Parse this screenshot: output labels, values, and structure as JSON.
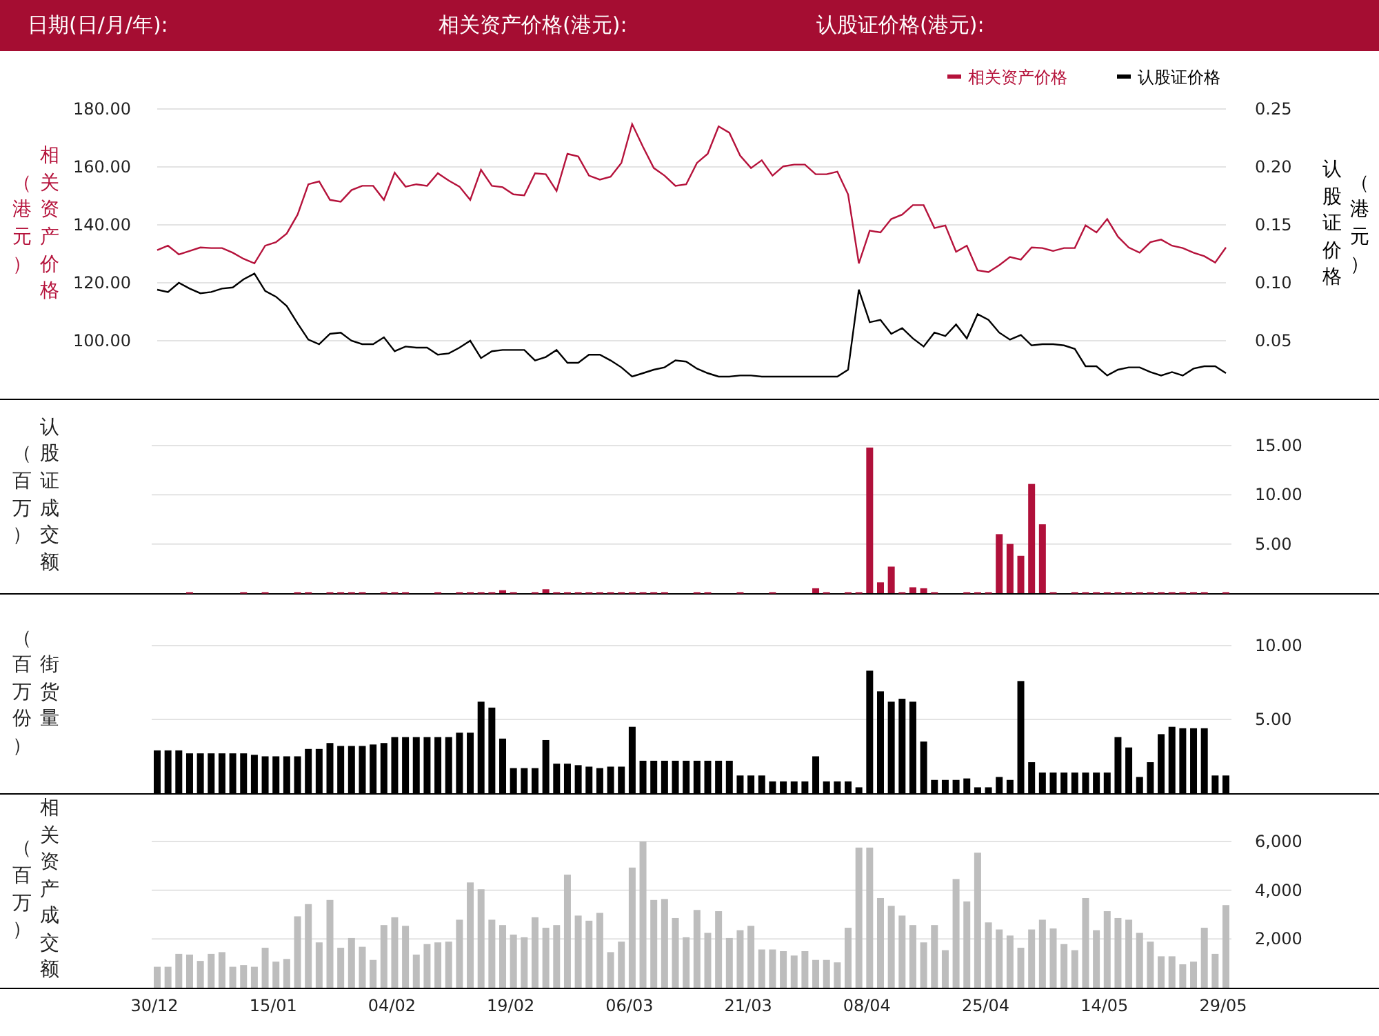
{
  "header": {
    "fields": [
      {
        "label": "日期(日/月/年):"
      },
      {
        "label": "相关资产价格(港元):"
      },
      {
        "label": "认股证价格(港元):"
      }
    ]
  },
  "price_chart": {
    "left_title": "相关资产价格",
    "left_unit": "（港元）",
    "right_title": "认股证价格",
    "right_unit": "（港元）",
    "chart_data": {
      "type": "line",
      "grid": true,
      "legend": "top-right",
      "ylim": [
        80,
        180
      ],
      "y2lim": [
        0,
        0.25
      ],
      "yticks": [
        {
          "value": 180,
          "label": "180.00"
        },
        {
          "value": 160,
          "label": "160.00"
        },
        {
          "value": 140,
          "label": "140.00"
        },
        {
          "value": 120,
          "label": "120.00"
        },
        {
          "value": 100,
          "label": "100.00"
        }
      ],
      "y2ticks": [
        {
          "value": 0.25,
          "label": "0.25"
        },
        {
          "value": 0.2,
          "label": "0.20"
        },
        {
          "value": 0.15,
          "label": "0.15"
        },
        {
          "value": 0.1,
          "label": "0.10"
        },
        {
          "value": 0.05,
          "label": "0.05"
        }
      ],
      "series": [
        {
          "name": "相关资产价格",
          "color": "#b5123b",
          "values": [
            131.3,
            132.8,
            129.8,
            131,
            132.2,
            132,
            132,
            130.4,
            128.3,
            126.7,
            132.8,
            134,
            137,
            143.5,
            154,
            155,
            148.6,
            148,
            152,
            153.5,
            153.5,
            148.6,
            158,
            153.2,
            154,
            153.5,
            157.8,
            155.3,
            153.2,
            148.6,
            159,
            153.5,
            153,
            150.5,
            150.2,
            157.8,
            157.5,
            151.7,
            164.5,
            163.6,
            157,
            155.6,
            156.6,
            161.4,
            174.8,
            166.9,
            159.6,
            157,
            153.5,
            154,
            161.4,
            164.5,
            174,
            171.8,
            163.9,
            159.6,
            162.3,
            157,
            160.2,
            160.8,
            160.8,
            157.5,
            157.5,
            158.4,
            150.5,
            126.7,
            138,
            137.4,
            142,
            143.5,
            146.8,
            146.8,
            138.9,
            139.8,
            130.7,
            132.8,
            124.3,
            123.7,
            126.1,
            128.9,
            128,
            132.2,
            132,
            131,
            132,
            132,
            139.8,
            137.4,
            142,
            135.9,
            132.2,
            130.4,
            134,
            134.9,
            132.8,
            132,
            130.4,
            129.2,
            127,
            132.2
          ]
        },
        {
          "name": "认股证价格",
          "color": "#000000",
          "axis": "y2",
          "values": [
            0.094,
            0.092,
            0.1,
            0.095,
            0.091,
            0.092,
            0.095,
            0.096,
            0.103,
            0.108,
            0.093,
            0.088,
            0.08,
            0.065,
            0.051,
            0.047,
            0.056,
            0.057,
            0.05,
            0.047,
            0.047,
            0.053,
            0.041,
            0.045,
            0.044,
            0.044,
            0.038,
            0.039,
            0.044,
            0.05,
            0.035,
            0.041,
            0.042,
            0.042,
            0.042,
            0.033,
            0.036,
            0.042,
            0.031,
            0.031,
            0.038,
            0.038,
            0.033,
            0.027,
            0.019,
            0.022,
            0.025,
            0.027,
            0.033,
            0.032,
            0.026,
            0.022,
            0.019,
            0.019,
            0.02,
            0.02,
            0.019,
            0.019,
            0.019,
            0.019,
            0.019,
            0.019,
            0.019,
            0.019,
            0.025,
            0.094,
            0.066,
            0.068,
            0.056,
            0.061,
            0.052,
            0.045,
            0.057,
            0.054,
            0.064,
            0.052,
            0.073,
            0.068,
            0.057,
            0.051,
            0.055,
            0.046,
            0.047,
            0.047,
            0.046,
            0.043,
            0.028,
            0.028,
            0.02,
            0.025,
            0.027,
            0.027,
            0.023,
            0.02,
            0.023,
            0.02,
            0.026,
            0.028,
            0.028,
            0.022
          ]
        }
      ]
    }
  },
  "volume_charts": [
    {
      "unit": "（百万）",
      "chart_data": {
        "type": "bar",
        "grid": true,
        "ylim": [
          0,
          15
        ],
        "yticks": [
          {
            "value": 15,
            "label": "15.00"
          },
          {
            "value": 10,
            "label": "10.00"
          },
          {
            "value": 5,
            "label": "5.00"
          }
        ],
        "series": [
          {
            "name": "认股证成交额",
            "color": "#b0103a",
            "values": [
              0,
              0,
              0,
              0.1,
              0,
              0,
              0,
              0,
              0.1,
              0,
              0.1,
              0,
              0,
              0.1,
              0.1,
              0,
              0.1,
              0.1,
              0.1,
              0.1,
              0,
              0.1,
              0.1,
              0.1,
              0,
              0,
              0.1,
              0,
              0.1,
              0.1,
              0.1,
              0.1,
              0.3,
              0.1,
              0,
              0.1,
              0.4,
              0.1,
              0.1,
              0.1,
              0.1,
              0.1,
              0.1,
              0.1,
              0.1,
              0.1,
              0.1,
              0.1,
              0,
              0,
              0.1,
              0.1,
              0,
              0,
              0.1,
              0,
              0,
              0.1,
              0,
              0,
              0,
              0.5,
              0.1,
              0,
              0.1,
              0.1,
              14.8,
              1.1,
              2.7,
              0.1,
              0.6,
              0.5,
              0.1,
              0,
              0,
              0.1,
              0.1,
              0.1,
              6,
              5,
              3.8,
              11.1,
              7,
              0.1,
              0,
              0.1,
              0.1,
              0.1,
              0.1,
              0.1,
              0.1,
              0.1,
              0.1,
              0.1,
              0.1,
              0.1,
              0.1,
              0.1,
              0,
              0.1
            ]
          }
        ]
      }
    },
    {
      "unit": "（百万份）",
      "chart_data": {
        "type": "bar",
        "grid": true,
        "ylim": [
          0,
          10
        ],
        "yticks": [
          {
            "value": 10,
            "label": "10.00"
          },
          {
            "value": 5,
            "label": "5.00"
          }
        ],
        "series": [
          {
            "name": "街货量",
            "color": "#000000",
            "values": [
              2.9,
              2.9,
              2.9,
              2.7,
              2.7,
              2.7,
              2.7,
              2.7,
              2.7,
              2.6,
              2.5,
              2.5,
              2.5,
              2.5,
              3,
              3,
              3.4,
              3.2,
              3.2,
              3.2,
              3.3,
              3.4,
              3.8,
              3.8,
              3.8,
              3.8,
              3.8,
              3.8,
              4.1,
              4.1,
              6.2,
              5.8,
              3.7,
              1.7,
              1.7,
              1.7,
              3.6,
              2,
              2,
              1.9,
              1.8,
              1.7,
              1.8,
              1.8,
              4.5,
              2.2,
              2.2,
              2.2,
              2.2,
              2.2,
              2.2,
              2.2,
              2.2,
              2.2,
              1.2,
              1.2,
              1.2,
              0.8,
              0.8,
              0.8,
              0.8,
              2.5,
              0.8,
              0.8,
              0.8,
              0.4,
              8.3,
              6.9,
              6.2,
              6.4,
              6.2,
              3.5,
              0.9,
              0.9,
              0.9,
              1,
              0.4,
              0.4,
              1.1,
              0.9,
              7.6,
              2.1,
              1.4,
              1.4,
              1.4,
              1.4,
              1.4,
              1.4,
              1.4,
              3.8,
              3.1,
              1.1,
              2.1,
              4,
              4.5,
              4.4,
              4.4,
              4.4,
              1.2,
              1.2
            ]
          }
        ]
      }
    },
    {
      "unit": "（百万）",
      "date_labels": [
        "30/12",
        "15/01",
        "04/02",
        "19/02",
        "06/03",
        "21/03",
        "08/04",
        "25/04",
        "14/05",
        "29/05"
      ],
      "chart_data": {
        "type": "bar",
        "grid": true,
        "ylim": [
          0,
          6000
        ],
        "yticks": [
          {
            "value": 6000,
            "label": "6,000"
          },
          {
            "value": 4000,
            "label": "4,000"
          },
          {
            "value": 2000,
            "label": "2,000"
          }
        ],
        "series": [
          {
            "name": "相关资产成交额",
            "color": "#bdbdbd",
            "values": [
              860,
              860,
              1390,
              1360,
              1100,
              1390,
              1460,
              860,
              930,
              860,
              1640,
              1070,
              1180,
              2930,
              3430,
              1860,
              3600,
              1640,
              2040,
              1680,
              1140,
              2570,
              2890,
              2540,
              1360,
              1790,
              1860,
              1890,
              2790,
              4320,
              4040,
              2790,
              2570,
              2180,
              2070,
              2890,
              2460,
              2570,
              4640,
              2960,
              2750,
              3070,
              1460,
              1890,
              4930,
              6000,
              3600,
              3640,
              2860,
              2070,
              3190,
              2250,
              3140,
              2040,
              2360,
              2540,
              1570,
              1570,
              1500,
              1320,
              1500,
              1140,
              1140,
              1040,
              2460,
              5750,
              5750,
              3680,
              3360,
              2960,
              2570,
              1860,
              2570,
              1540,
              4460,
              3540,
              5540,
              2680,
              2390,
              2140,
              1640,
              2390,
              2790,
              2430,
              1790,
              1540,
              3680,
              2360,
              3140,
              2860,
              2790,
              2250,
              1890,
              1290,
              1290,
              960,
              1070,
              2460,
              1390,
              3390
            ]
          }
        ]
      }
    }
  ]
}
